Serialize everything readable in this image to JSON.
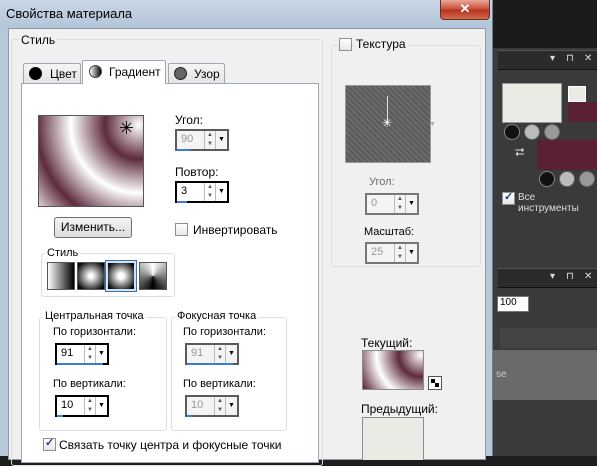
{
  "dialog": {
    "title": "Свойства материала",
    "close_label": "✕"
  },
  "style_group": {
    "label": "Стиль",
    "tabs": [
      {
        "label": "Цвет"
      },
      {
        "label": "Градиент"
      },
      {
        "label": "Узор"
      }
    ]
  },
  "gradient": {
    "angle_label": "Угол:",
    "angle_value": "90",
    "repeat_label": "Повтор:",
    "repeat_value": "3",
    "edit_button": "Изменить...",
    "invert_label": "Инвертировать",
    "invert_checked": false,
    "style_label": "Стиль",
    "center_point": {
      "label": "Центральная точка",
      "h_label": "По горизонтали:",
      "h_value": "91",
      "v_label": "По вертикали:",
      "v_value": "10"
    },
    "focal_point": {
      "label": "Фокусная точка",
      "h_label": "По горизонтали:",
      "h_value": "91",
      "v_label": "По вертикали:",
      "v_value": "10"
    },
    "link_label": "Связать точку центра и фокусные точки",
    "link_checked": true
  },
  "texture": {
    "label": "Текстура",
    "checked": false,
    "angle_label": "Угол:",
    "angle_value": "0",
    "scale_label": "Масштаб:",
    "scale_value": "25"
  },
  "preview": {
    "current_label": "Текущий:",
    "previous_label": "Предыдущий:"
  },
  "background_app": {
    "all_tools_label": "Все инструменты",
    "zoom_value": "100",
    "fragment_text": "se"
  },
  "colors": {
    "gradient_dark": "#5e2a3e",
    "gradient_light": "#ffffff",
    "accent_blue": "#3a7bd5"
  }
}
